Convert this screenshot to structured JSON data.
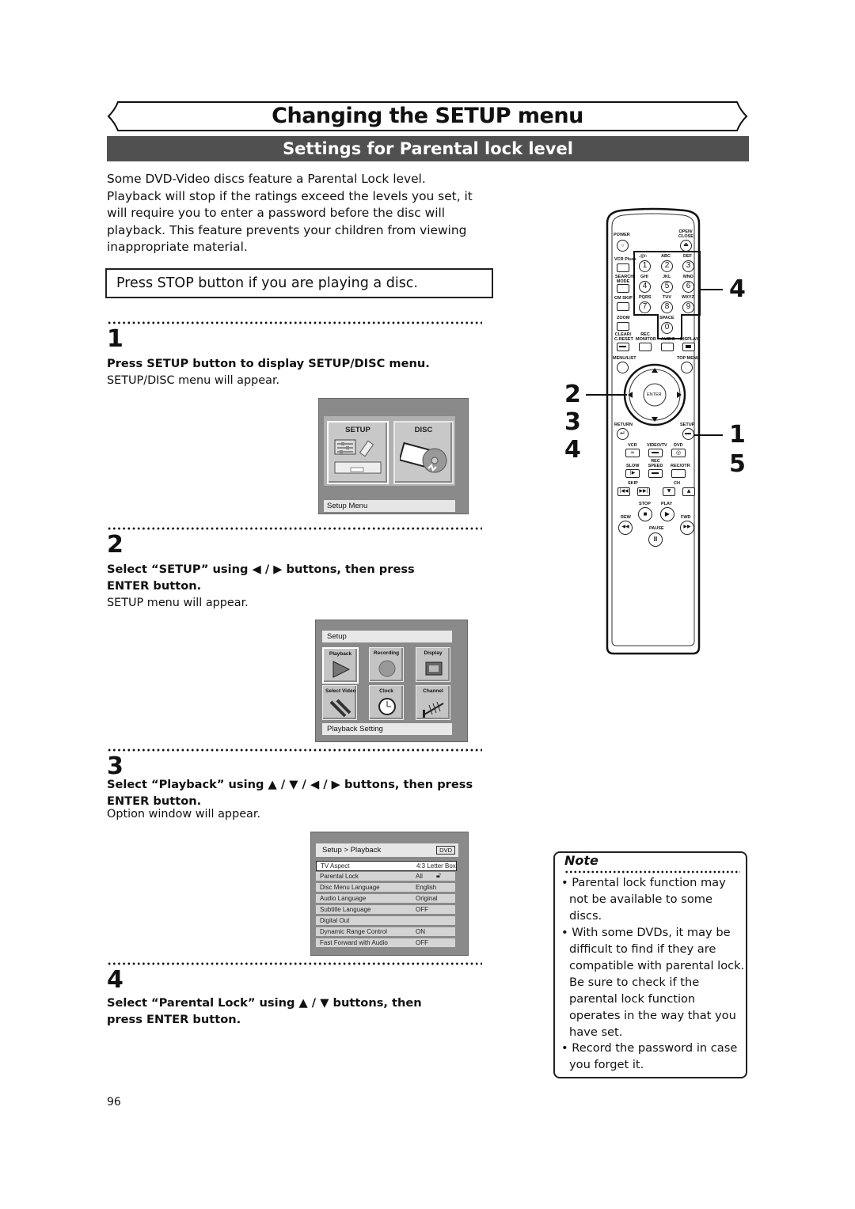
{
  "header": {
    "title": "Changing the SETUP menu",
    "section": "Settings for Parental lock level"
  },
  "intro": "Some DVD-Video discs feature a Parental Lock level. Playback will stop if the ratings exceed the levels you set, it will require you to enter a password before the disc will playback. This feature prevents your children from viewing inappropriate material.",
  "stop_notice": "Press STOP button if you are playing a disc.",
  "steps": [
    {
      "number": "1",
      "instruction": "Press SETUP button to display SETUP/DISC menu.",
      "result": "SETUP/DISC menu will appear."
    },
    {
      "number": "2",
      "instruction": "Select “SETUP” using ◀ / ▶ buttons, then press ENTER button.",
      "result": "SETUP menu will appear."
    },
    {
      "number": "3",
      "instruction": "Select “Playback” using ▲ / ▼ / ◀ / ▶ buttons, then press ENTER button.",
      "result": "Option window will appear."
    },
    {
      "number": "4",
      "instruction": "Select “Parental Lock” using ▲ / ▼ buttons, then press ENTER button.",
      "result": ""
    }
  ],
  "screen1": {
    "tiles": [
      "SETUP",
      "DISC"
    ],
    "caption": "Setup Menu"
  },
  "screen2": {
    "header": "Setup",
    "tiles": [
      "Playback",
      "Recording",
      "Display",
      "Select Video",
      "Clock",
      "Channel"
    ],
    "caption": "Playback Setting"
  },
  "screen3": {
    "header": "Setup > Playback",
    "badge": "DVD",
    "rows": [
      {
        "label": "TV Aspect",
        "value": "4:3 Letter Box"
      },
      {
        "label": "Parental Lock",
        "value": "All"
      },
      {
        "label": "Disc Menu Language",
        "value": "English"
      },
      {
        "label": "Audio Language",
        "value": "Original"
      },
      {
        "label": "Subtitle Language",
        "value": "OFF"
      },
      {
        "label": "Digital Out",
        "value": ""
      },
      {
        "label": "Dynamic Range Control",
        "value": "ON"
      },
      {
        "label": "Fast Forward with Audio",
        "value": "OFF"
      }
    ]
  },
  "remote": {
    "labels": {
      "power": "POWER",
      "open_close": "OPEN/ CLOSE",
      "vcr_plus": "VCR Plus+",
      "search_mode": "SEARCH MODE",
      "cm_skip": "CM SKIP",
      "zoom": "ZOOM",
      "clear": "CLEAR/ C.RESET",
      "rec_monitor": "REC MONITOR",
      "audio": "AUDIO",
      "display": "DISPLAY",
      "menu_list": "MENU/LIST",
      "top_menu": "TOP MENU",
      "enter": "ENTER",
      "return": "RETURN",
      "setup": "SETUP",
      "vcr": "VCR",
      "video_tv": "VIDEO/TV",
      "dvd": "DVD",
      "slow": "SLOW",
      "rec_speed": "REC SPEED",
      "rec_otr": "REC/OTR",
      "skip": "SKIP",
      "ch": "CH",
      "stop": "STOP",
      "play": "PLAY",
      "rew": "REW",
      "fwd": "FWD",
      "pause": "PAUSE",
      "space": "SPACE"
    },
    "keypad": [
      {
        "digit": "1",
        "letters": ".@/:"
      },
      {
        "digit": "2",
        "letters": "ABC"
      },
      {
        "digit": "3",
        "letters": "DEF"
      },
      {
        "digit": "4",
        "letters": "GHI"
      },
      {
        "digit": "5",
        "letters": "JKL"
      },
      {
        "digit": "6",
        "letters": "MNO"
      },
      {
        "digit": "7",
        "letters": "PQRS"
      },
      {
        "digit": "8",
        "letters": "TUV"
      },
      {
        "digit": "9",
        "letters": "WXYZ"
      },
      {
        "digit": "0",
        "letters": "SPACE"
      }
    ],
    "callouts": {
      "keypad": "4",
      "arrows": [
        "2",
        "3",
        "4"
      ],
      "setup": [
        "1",
        "5"
      ]
    }
  },
  "note": {
    "title": "Note",
    "items": [
      "• Parental lock function may not be available to some discs.",
      "•  With some DVDs, it may be difficult to find if they are compatible with parental lock. Be sure to check if the parental lock function operates in the way that you have set.",
      "• Record the password in case you forget it."
    ]
  },
  "page_number": "96"
}
